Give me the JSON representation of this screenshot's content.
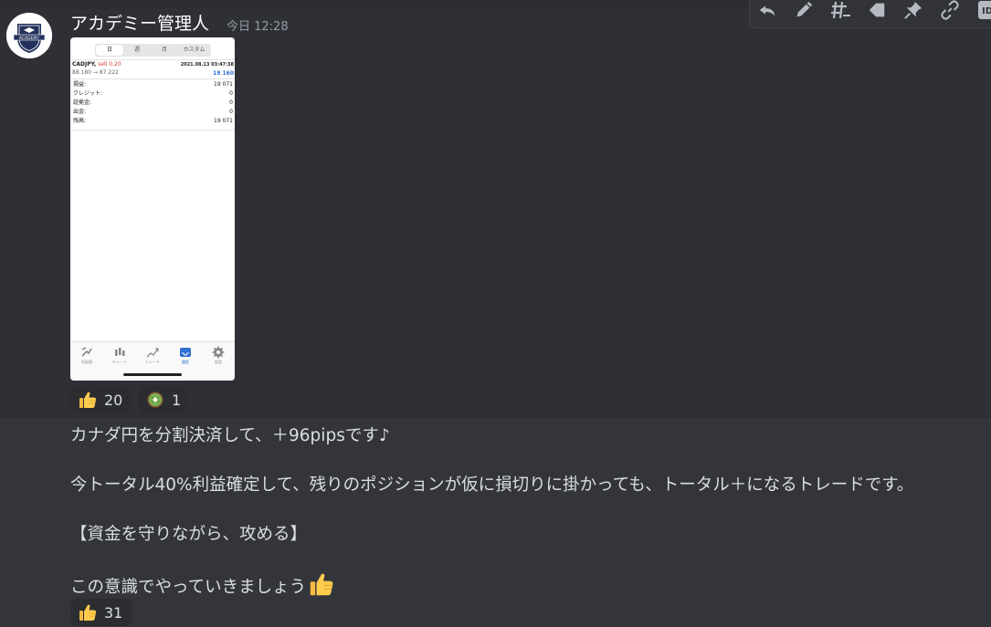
{
  "message": {
    "author": "アカデミー管理人",
    "timestamp": "今日 12:28",
    "avatar_text": "ACADEMY"
  },
  "toolbar": {
    "buttons": [
      "reply-icon",
      "edit-icon",
      "create-thread-icon",
      "tag-icon",
      "pin-icon",
      "copy-link-icon",
      "copy-id-icon"
    ],
    "id_label": "ID"
  },
  "attachment": {
    "tabs": [
      "日",
      "週",
      "月",
      "カスタム"
    ],
    "active_tab": "日",
    "symbol": "CADJPY,",
    "side": "sell 0.20",
    "datetime": "2021.08.13 03:47:38",
    "prices": "88.180 → 87.222",
    "profit_value": "19 160",
    "rows": [
      {
        "label": "損益:",
        "value": "19 071"
      },
      {
        "label": "クレジット:",
        "value": "0"
      },
      {
        "label": "証拠金:",
        "value": "0"
      },
      {
        "label": "出金:",
        "value": "0"
      },
      {
        "label": "残高:",
        "value": "19 071"
      }
    ],
    "nav": [
      {
        "label": "気配値",
        "icon": "quotes-icon"
      },
      {
        "label": "チャート",
        "icon": "chart-icon"
      },
      {
        "label": "トレード",
        "icon": "trade-icon"
      },
      {
        "label": "履歴",
        "icon": "history-icon"
      },
      {
        "label": "設定",
        "icon": "settings-icon"
      }
    ]
  },
  "reactions_top": [
    {
      "emoji": "thumbs-up-icon",
      "count": "20"
    },
    {
      "emoji": "kiwi-icon",
      "count": "1"
    }
  ],
  "text": {
    "line1": "カナダ円を分割決済して、＋96pipsです♪",
    "line2": "今トータル40%利益確定して、残りのポジションが仮に損切りに掛かっても、トータル＋になるトレードです。",
    "line3": "【資金を守りながら、攻める】",
    "line4": "この意識でやっていきましょう"
  },
  "reactions_bottom": [
    {
      "emoji": "thumbs-up-icon",
      "count": "31"
    }
  ],
  "colors": {
    "background": "#33353b",
    "hover_background": "#2e3035",
    "reaction_background": "#2b2d31",
    "accent_blue": "#2f6fd0",
    "sell_red": "#d23a2a"
  }
}
